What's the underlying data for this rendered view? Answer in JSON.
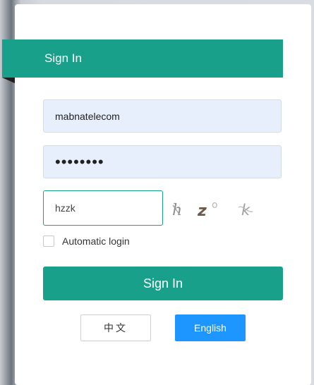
{
  "header": {
    "title": "Sign In"
  },
  "form": {
    "username_value": "mabnatelecom",
    "password_value": "••••••••",
    "captcha_value": "hzzk",
    "captcha_image_text": "hzok",
    "auto_login_label": "Automatic login",
    "auto_login_checked": false,
    "submit_label": "Sign In"
  },
  "languages": {
    "chinese_label": "中文",
    "english_label": "English",
    "selected": "English"
  },
  "colors": {
    "accent": "#19a08a",
    "language_active": "#1e96ff",
    "input_bg": "#e8effc"
  }
}
